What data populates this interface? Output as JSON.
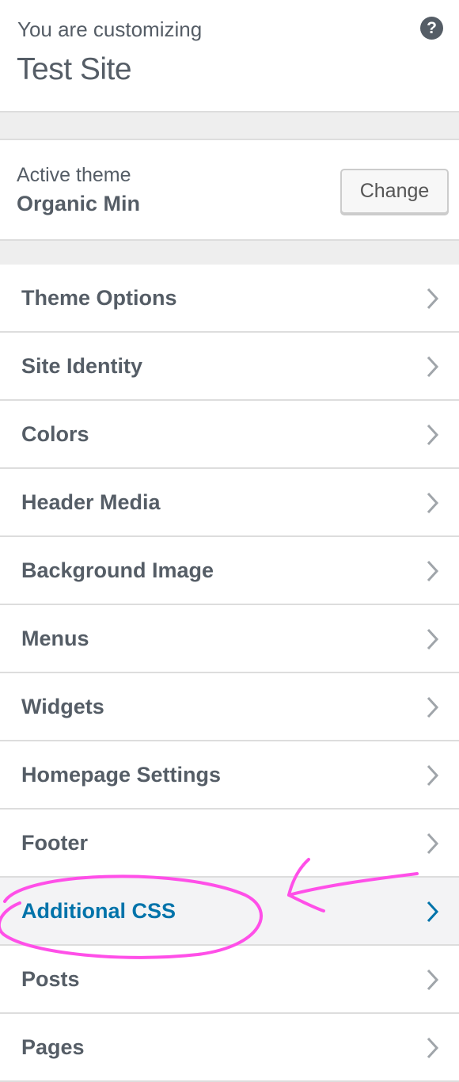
{
  "header": {
    "label": "You are customizing",
    "site_title": "Test Site",
    "help_glyph": "?"
  },
  "theme": {
    "label": "Active theme",
    "name": "Organic Min",
    "change_label": "Change"
  },
  "menu": {
    "items": [
      {
        "label": "Theme Options",
        "icon": "chevron-right-icon"
      },
      {
        "label": "Site Identity",
        "icon": "chevron-right-icon"
      },
      {
        "label": "Colors",
        "icon": "chevron-right-icon"
      },
      {
        "label": "Header Media",
        "icon": "chevron-right-icon"
      },
      {
        "label": "Background Image",
        "icon": "chevron-right-icon"
      },
      {
        "label": "Menus",
        "icon": "chevron-right-icon"
      },
      {
        "label": "Widgets",
        "icon": "chevron-right-icon"
      },
      {
        "label": "Homepage Settings",
        "icon": "chevron-right-icon"
      },
      {
        "label": "Footer",
        "icon": "chevron-right-icon"
      },
      {
        "label": "Additional CSS",
        "icon": "chevron-right-icon",
        "active": true
      },
      {
        "label": "Posts",
        "icon": "chevron-right-icon"
      },
      {
        "label": "Pages",
        "icon": "chevron-right-icon"
      }
    ]
  },
  "colors": {
    "text": "#555d66",
    "active_link": "#0073aa",
    "annotation": "#ff4fe8",
    "separator": "#eeeeee"
  }
}
